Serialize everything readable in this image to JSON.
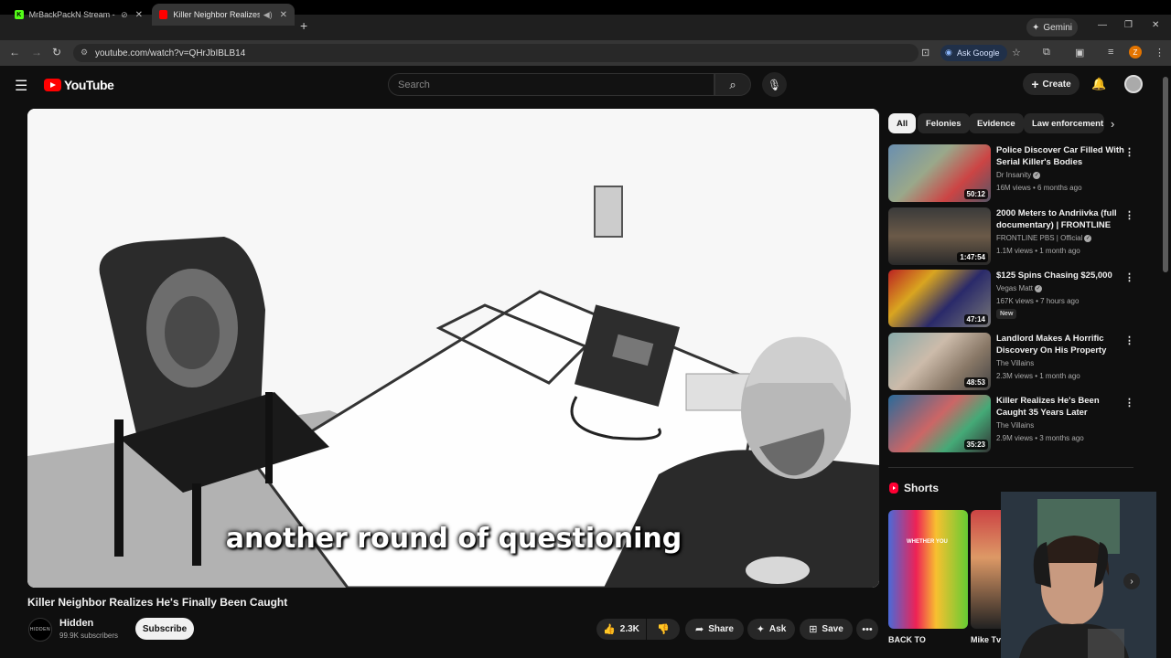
{
  "browser": {
    "tabs": [
      {
        "title": "MrBackPackN Stream - Wa",
        "favicon": "K"
      },
      {
        "title": "Killer Neighbor Realizes He",
        "favicon": "youtube"
      }
    ],
    "new_tab": "+",
    "gemini_label": "Gemini",
    "url": "youtube.com/watch?v=QHrJbIBLB14",
    "ask_google": "Ask Google",
    "profile_initial": "Z"
  },
  "youtube": {
    "logo_text": "YouTube",
    "search_placeholder": "Search",
    "create_label": "Create"
  },
  "player": {
    "caption": "another round of questioning"
  },
  "video": {
    "title": "Killer Neighbor Realizes He's Finally Been Caught",
    "channel_name": "Hidden",
    "channel_avatar_text": "HIDDEN",
    "subscribers": "99.9K subscribers",
    "subscribe_label": "Subscribe",
    "likes": "2.3K",
    "share_label": "Share",
    "ask_label": "Ask",
    "save_label": "Save"
  },
  "chips": [
    "All",
    "Felonies",
    "Evidence",
    "Law enforcement"
  ],
  "recommendations": [
    {
      "title": "Police Discover Car Filled With Serial Killer's Bodies",
      "channel": "Dr Insanity",
      "verified": true,
      "meta": "16M views • 6 months ago",
      "duration": "50:12",
      "badge": ""
    },
    {
      "title": "2000 Meters to Andriivka (full documentary) | FRONTLINE",
      "channel": "FRONTLINE PBS | Official",
      "verified": true,
      "meta": "1.1M views • 1 month ago",
      "duration": "1:47:54",
      "badge": ""
    },
    {
      "title": "$125 Spins Chasing $25,000",
      "channel": "Vegas Matt",
      "verified": true,
      "meta": "167K views • 7 hours ago",
      "duration": "47:14",
      "badge": "New"
    },
    {
      "title": "Landlord Makes A Horrific Discovery On His Property",
      "channel": "The Villains",
      "verified": false,
      "meta": "2.3M views • 1 month ago",
      "duration": "48:53",
      "badge": ""
    },
    {
      "title": "Killer Realizes He's Been Caught 35 Years Later",
      "channel": "The Villains",
      "verified": false,
      "meta": "2.9M views • 3 months ago",
      "duration": "35:23",
      "badge": ""
    }
  ],
  "shorts": {
    "heading": "Shorts",
    "items": [
      {
        "label": "BACK TO",
        "thumb_text": "WHETHER YOU"
      },
      {
        "label": "Mike Tv",
        "thumb_text": ""
      }
    ]
  }
}
